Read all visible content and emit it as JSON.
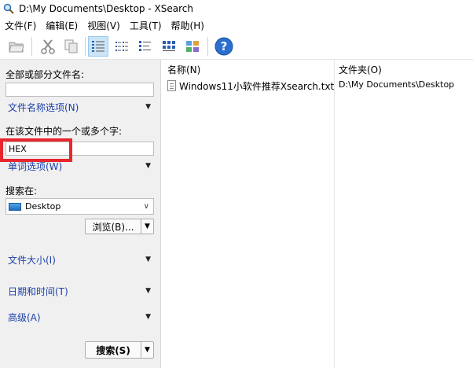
{
  "window": {
    "title": "D:\\My Documents\\Desktop - XSearch"
  },
  "menu": [
    "文件(F)",
    "编辑(E)",
    "视图(V)",
    "工具(T)",
    "帮助(H)"
  ],
  "toolbar": {
    "icons": [
      "open-folder-icon",
      "cut-icon",
      "copy-icon",
      "details-view-icon",
      "list-view-icon",
      "small-icons-view-icon",
      "large-icons-view-icon",
      "thumbnails-view-icon",
      "help-icon"
    ],
    "active": "details-view-icon",
    "help_label": "?"
  },
  "search_panel": {
    "filename_label": "全部或部分文件名:",
    "filename_value": "",
    "filename_options": "文件名称选项(N)",
    "content_label": "在该文件中的一个或多个字:",
    "content_value": "HEX",
    "word_options": "单词选项(W)",
    "search_in_label": "搜索在:",
    "search_in_value": "Desktop",
    "browse_label": "浏览(B)...",
    "file_size": "文件大小(I)",
    "date_time": "日期和时间(T)",
    "advanced": "高级(A)",
    "search_button": "搜索(S)"
  },
  "results": {
    "columns": [
      "名称(N)",
      "文件夹(O)"
    ],
    "rows": [
      {
        "name": "Windows11小软件推荐Xsearch.txt",
        "folder": "D:\\My Documents\\Desktop"
      }
    ]
  },
  "colors": {
    "highlight": "#e8262d",
    "link": "#1b3fa8",
    "selected_tool": "#cce4f7"
  }
}
